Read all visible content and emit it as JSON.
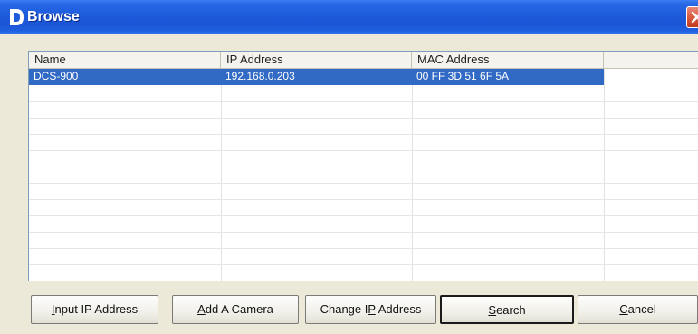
{
  "window": {
    "title": "Browse",
    "app_icon": "d-link-d-icon",
    "close_icon": "close-icon"
  },
  "list": {
    "columns": [
      "Name",
      "IP Address",
      "MAC Address",
      ""
    ],
    "rows": [
      {
        "name": "DCS-900",
        "ip": "192.168.0.203",
        "mac": "00 FF 3D 51 6F 5A",
        "selected": true
      }
    ],
    "selection_color": "#316ac5"
  },
  "buttons": {
    "input_ip": {
      "pre": "",
      "accel": "I",
      "post": "nput IP Address"
    },
    "add_camera": {
      "pre": "",
      "accel": "A",
      "post": "dd A Camera"
    },
    "change_ip": {
      "pre": "Change I",
      "accel": "P",
      "post": " Address"
    },
    "search": {
      "pre": "",
      "accel": "S",
      "post": "earch"
    },
    "cancel": {
      "pre": "",
      "accel": "C",
      "post": "ancel"
    }
  },
  "colors": {
    "titlebar": "#1d5bdc",
    "dialog_bg": "#ece9d8",
    "close_button": "#d95a3e"
  }
}
